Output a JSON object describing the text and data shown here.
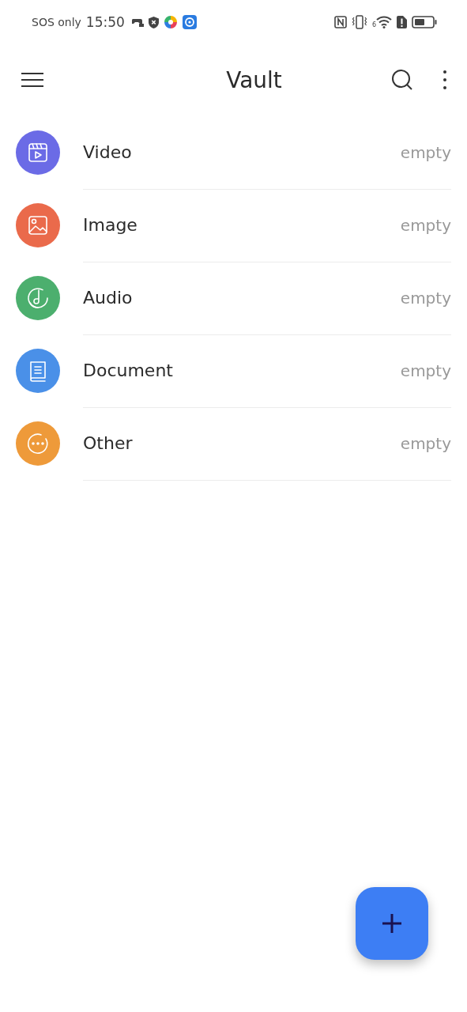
{
  "status_bar": {
    "carrier": "SOS only",
    "time": "15:50",
    "wifi_label": "6"
  },
  "app_bar": {
    "title": "Vault"
  },
  "categories": [
    {
      "kind": "video",
      "name": "Video",
      "status": "empty",
      "color": "#6b6be6"
    },
    {
      "kind": "image",
      "name": "Image",
      "status": "empty",
      "color": "#ea6a4b"
    },
    {
      "kind": "audio",
      "name": "Audio",
      "status": "empty",
      "color": "#4caf6e"
    },
    {
      "kind": "document",
      "name": "Document",
      "status": "empty",
      "color": "#4a90e8"
    },
    {
      "kind": "other",
      "name": "Other",
      "status": "empty",
      "color": "#ee9a3a"
    }
  ]
}
